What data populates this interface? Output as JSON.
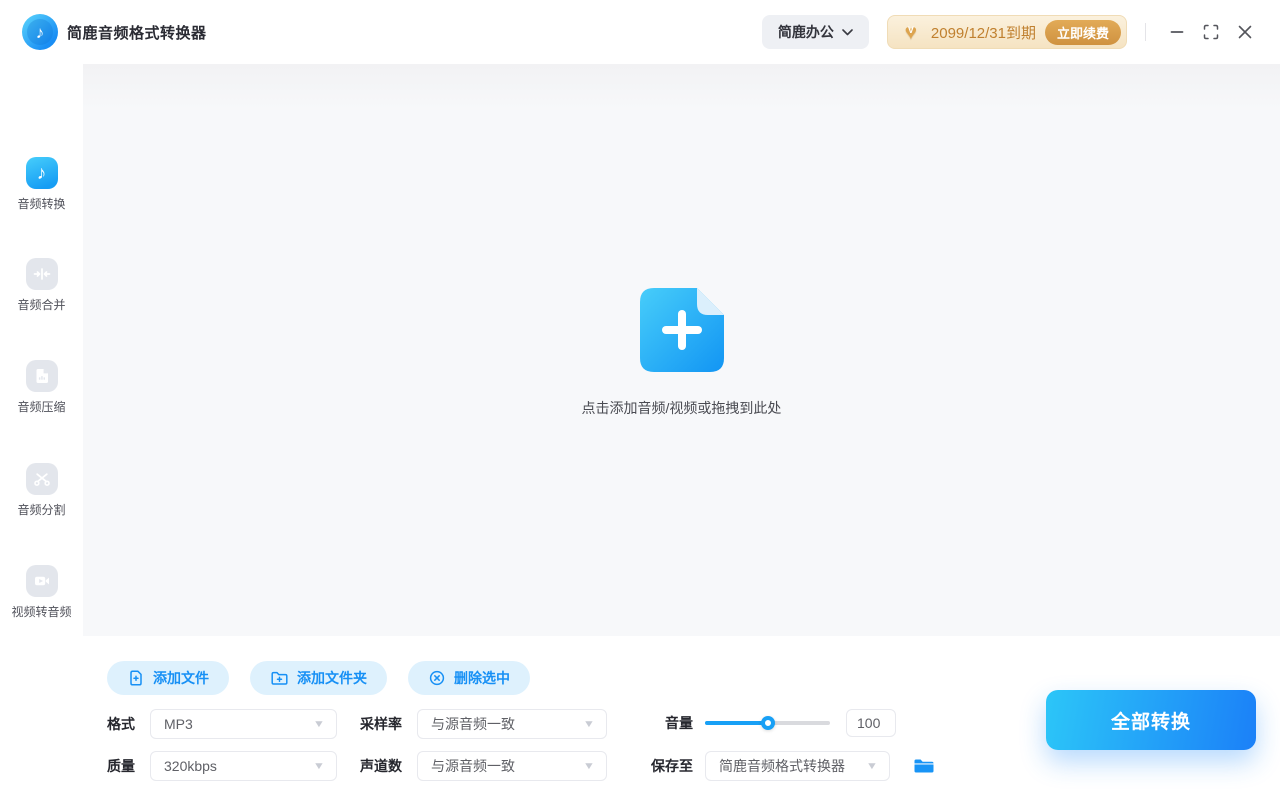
{
  "header": {
    "app_title": "简鹿音频格式转换器",
    "logo_icon": "music-note-logo",
    "office_menu": {
      "label": "简鹿办公",
      "icon": "chevron-down"
    },
    "vip": {
      "icon": "vip-heart-badge",
      "expiry_text": "2099/12/31到期",
      "renew_label": "立即续费"
    },
    "window_controls": {
      "minimize_icon": "minimize",
      "maximize_icon": "maximize",
      "close_icon": "close"
    }
  },
  "sidebar": {
    "items": [
      {
        "label": "音频转换",
        "icon": "music-note",
        "active": true
      },
      {
        "label": "音频合并",
        "icon": "merge-arrows",
        "active": false
      },
      {
        "label": "音频压缩",
        "icon": "compress-file",
        "active": false
      },
      {
        "label": "音频分割",
        "icon": "scissors",
        "active": false
      },
      {
        "label": "视频转音频",
        "icon": "video-camera",
        "active": false
      }
    ]
  },
  "dropzone": {
    "icon": "add-file",
    "hint": "点击添加音频/视频或拖拽到此处"
  },
  "toolbar": {
    "add_file_label": "添加文件",
    "add_file_icon": "file-plus",
    "add_folder_label": "添加文件夹",
    "add_folder_icon": "folder-plus",
    "delete_selected_label": "删除选中",
    "delete_selected_icon": "circle-x"
  },
  "settings": {
    "format": {
      "label": "格式",
      "value": "MP3"
    },
    "sample_rate": {
      "label": "采样率",
      "value": "与源音频一致"
    },
    "volume": {
      "label": "音量",
      "value": "100",
      "slider_percent": 50
    },
    "quality": {
      "label": "质量",
      "value": "320kbps"
    },
    "channels": {
      "label": "声道数",
      "value": "与源音频一致"
    },
    "save_to": {
      "label": "保存至",
      "value": "简鹿音频格式转换器",
      "browse_icon": "folder-open"
    }
  },
  "convert_all_label": "全部转换",
  "colors": {
    "accent_blue": "#1790f5",
    "slider_blue": "#18a0f6",
    "convert_gradient": [
      "#2cc6f8",
      "#1b80f8"
    ],
    "active_icon_gradient": [
      "#47cefb",
      "#169df4"
    ],
    "inactive_icon_bg": "#e3e6ec",
    "toolbar_pill_bg": "#def1fd",
    "vip_text": "#c0802f",
    "vip_pill_bg": "#f7e8cd",
    "renew_bg": "#d49a45",
    "main_bg": "#f7f8fa"
  }
}
